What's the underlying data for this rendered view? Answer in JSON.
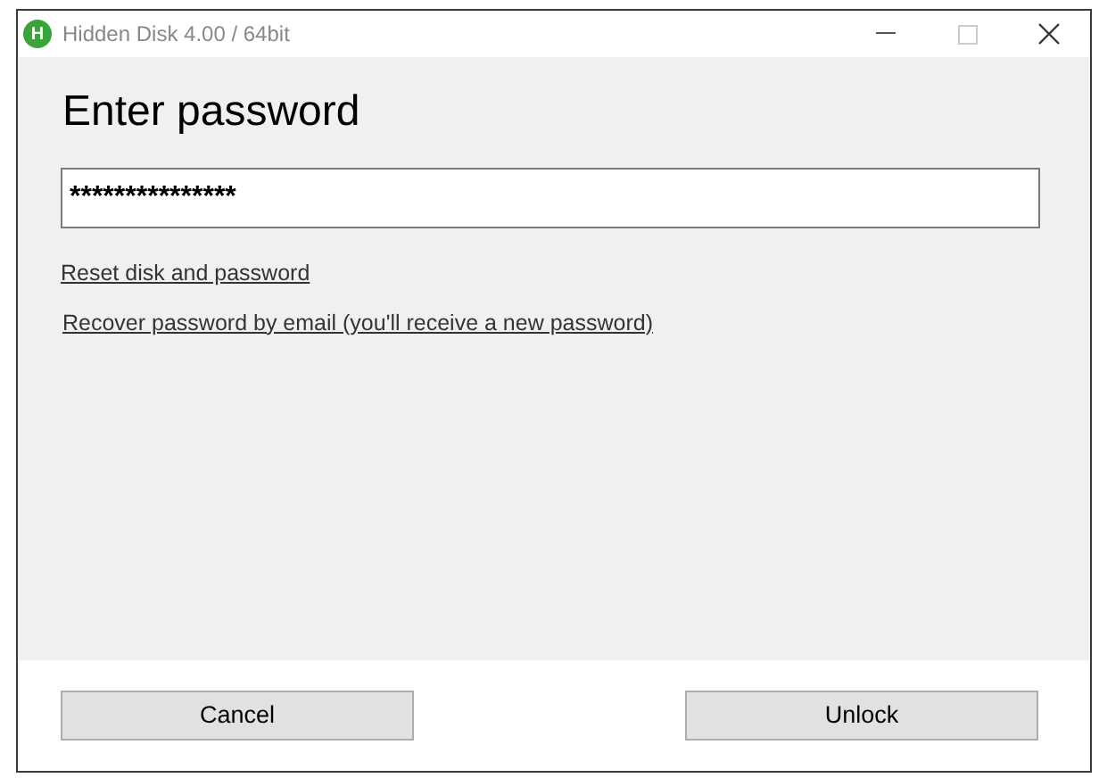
{
  "window": {
    "title": "Hidden Disk 4.00 / 64bit",
    "app_icon_letter": "H"
  },
  "heading": "Enter password",
  "password_field": {
    "value": "***************"
  },
  "links": [
    "Reset disk and password",
    "Recover password by email (you'll receive a new password)"
  ],
  "buttons": [
    "Cancel",
    "Unlock"
  ]
}
